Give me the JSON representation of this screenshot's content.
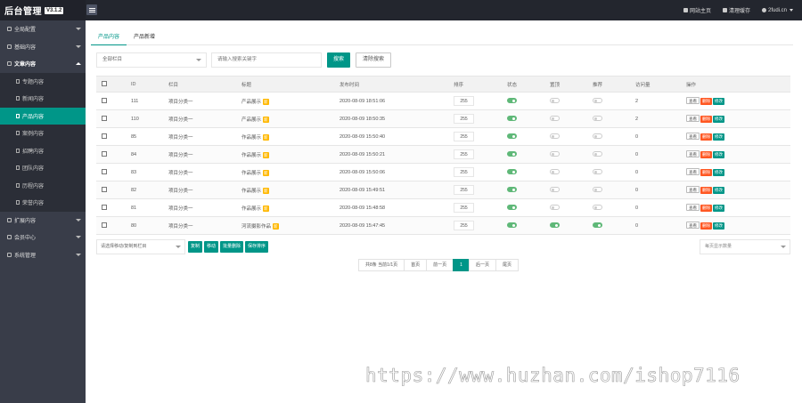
{
  "header": {
    "logo_text": "后台管理",
    "version": "V3.1.2",
    "links": [
      {
        "label": "网站主页",
        "icon": "home-icon"
      },
      {
        "label": "清理缓存",
        "icon": "trash-icon"
      },
      {
        "label": "2fudi.cn",
        "icon": "user-icon"
      }
    ]
  },
  "sidebar": {
    "items": [
      {
        "label": "全局配置",
        "icon": "settings-icon"
      },
      {
        "label": "基础内容",
        "icon": "list-icon"
      },
      {
        "label": "文章内容",
        "icon": "file-icon"
      },
      {
        "label": "扩展内容",
        "icon": "wrench-icon"
      },
      {
        "label": "会员中心",
        "icon": "user-icon"
      },
      {
        "label": "系统管理",
        "icon": "gear-icon"
      }
    ],
    "sub_items": [
      "专题内容",
      "新闻内容",
      "产品内容",
      "案例内容",
      "招聘内容",
      "团队内容",
      "历程内容",
      "荣誉内容"
    ],
    "active_sub": "产品内容"
  },
  "tabs": [
    "产品内容",
    "产品新增"
  ],
  "filter": {
    "category": "全部栏目",
    "keyword_placeholder": "请输入搜索关键字",
    "search_label": "搜索",
    "clear_label": "清除搜索"
  },
  "table": {
    "headers": [
      "",
      "ID",
      "栏目",
      "标题",
      "发布时间",
      "排序",
      "状态",
      "置顶",
      "推荐",
      "访问量",
      "操作"
    ],
    "new_tag": "新",
    "ops": {
      "view": "查看",
      "delete": "删除",
      "edit": "修改"
    },
    "rows": [
      {
        "id": "111",
        "column": "项目分类一",
        "title": "产品展示",
        "time": "2020-08-09 18:51:06",
        "sort": "255",
        "status": true,
        "top": false,
        "recommend": false,
        "visits": "2"
      },
      {
        "id": "110",
        "column": "项目分类一",
        "title": "产品展示",
        "time": "2020-08-09 18:50:35",
        "sort": "255",
        "status": true,
        "top": false,
        "recommend": false,
        "visits": "2"
      },
      {
        "id": "85",
        "column": "项目分类一",
        "title": "作品展示",
        "time": "2020-08-09 15:50:40",
        "sort": "255",
        "status": true,
        "top": false,
        "recommend": false,
        "visits": "0"
      },
      {
        "id": "84",
        "column": "项目分类一",
        "title": "作品展示",
        "time": "2020-08-09 15:50:21",
        "sort": "255",
        "status": true,
        "top": false,
        "recommend": false,
        "visits": "0"
      },
      {
        "id": "83",
        "column": "项目分类一",
        "title": "作品展示",
        "time": "2020-08-09 15:50:06",
        "sort": "255",
        "status": true,
        "top": false,
        "recommend": false,
        "visits": "0"
      },
      {
        "id": "82",
        "column": "项目分类一",
        "title": "作品展示",
        "time": "2020-08-09 15:49:51",
        "sort": "255",
        "status": true,
        "top": false,
        "recommend": false,
        "visits": "0"
      },
      {
        "id": "81",
        "column": "项目分类一",
        "title": "作品展示",
        "time": "2020-08-09 15:48:58",
        "sort": "255",
        "status": true,
        "top": false,
        "recommend": false,
        "visits": "0"
      },
      {
        "id": "80",
        "column": "项目分类一",
        "title": "河流摄影作品",
        "time": "2020-08-09 15:47:45",
        "sort": "255",
        "status": true,
        "top": true,
        "recommend": true,
        "visits": "0"
      }
    ]
  },
  "batch": {
    "select_label": "请选择移动/复制到栏目",
    "buttons": [
      "复制",
      "移动",
      "批量删除",
      "保存排序"
    ],
    "pagesize_label": "每页显示数量"
  },
  "pager": [
    "共8条 当前1/1页",
    "首页",
    "前一页",
    "1",
    "后一页",
    "尾页"
  ],
  "pager_current": "1",
  "watermark": "https://www.huzhan.com/ishop7116"
}
